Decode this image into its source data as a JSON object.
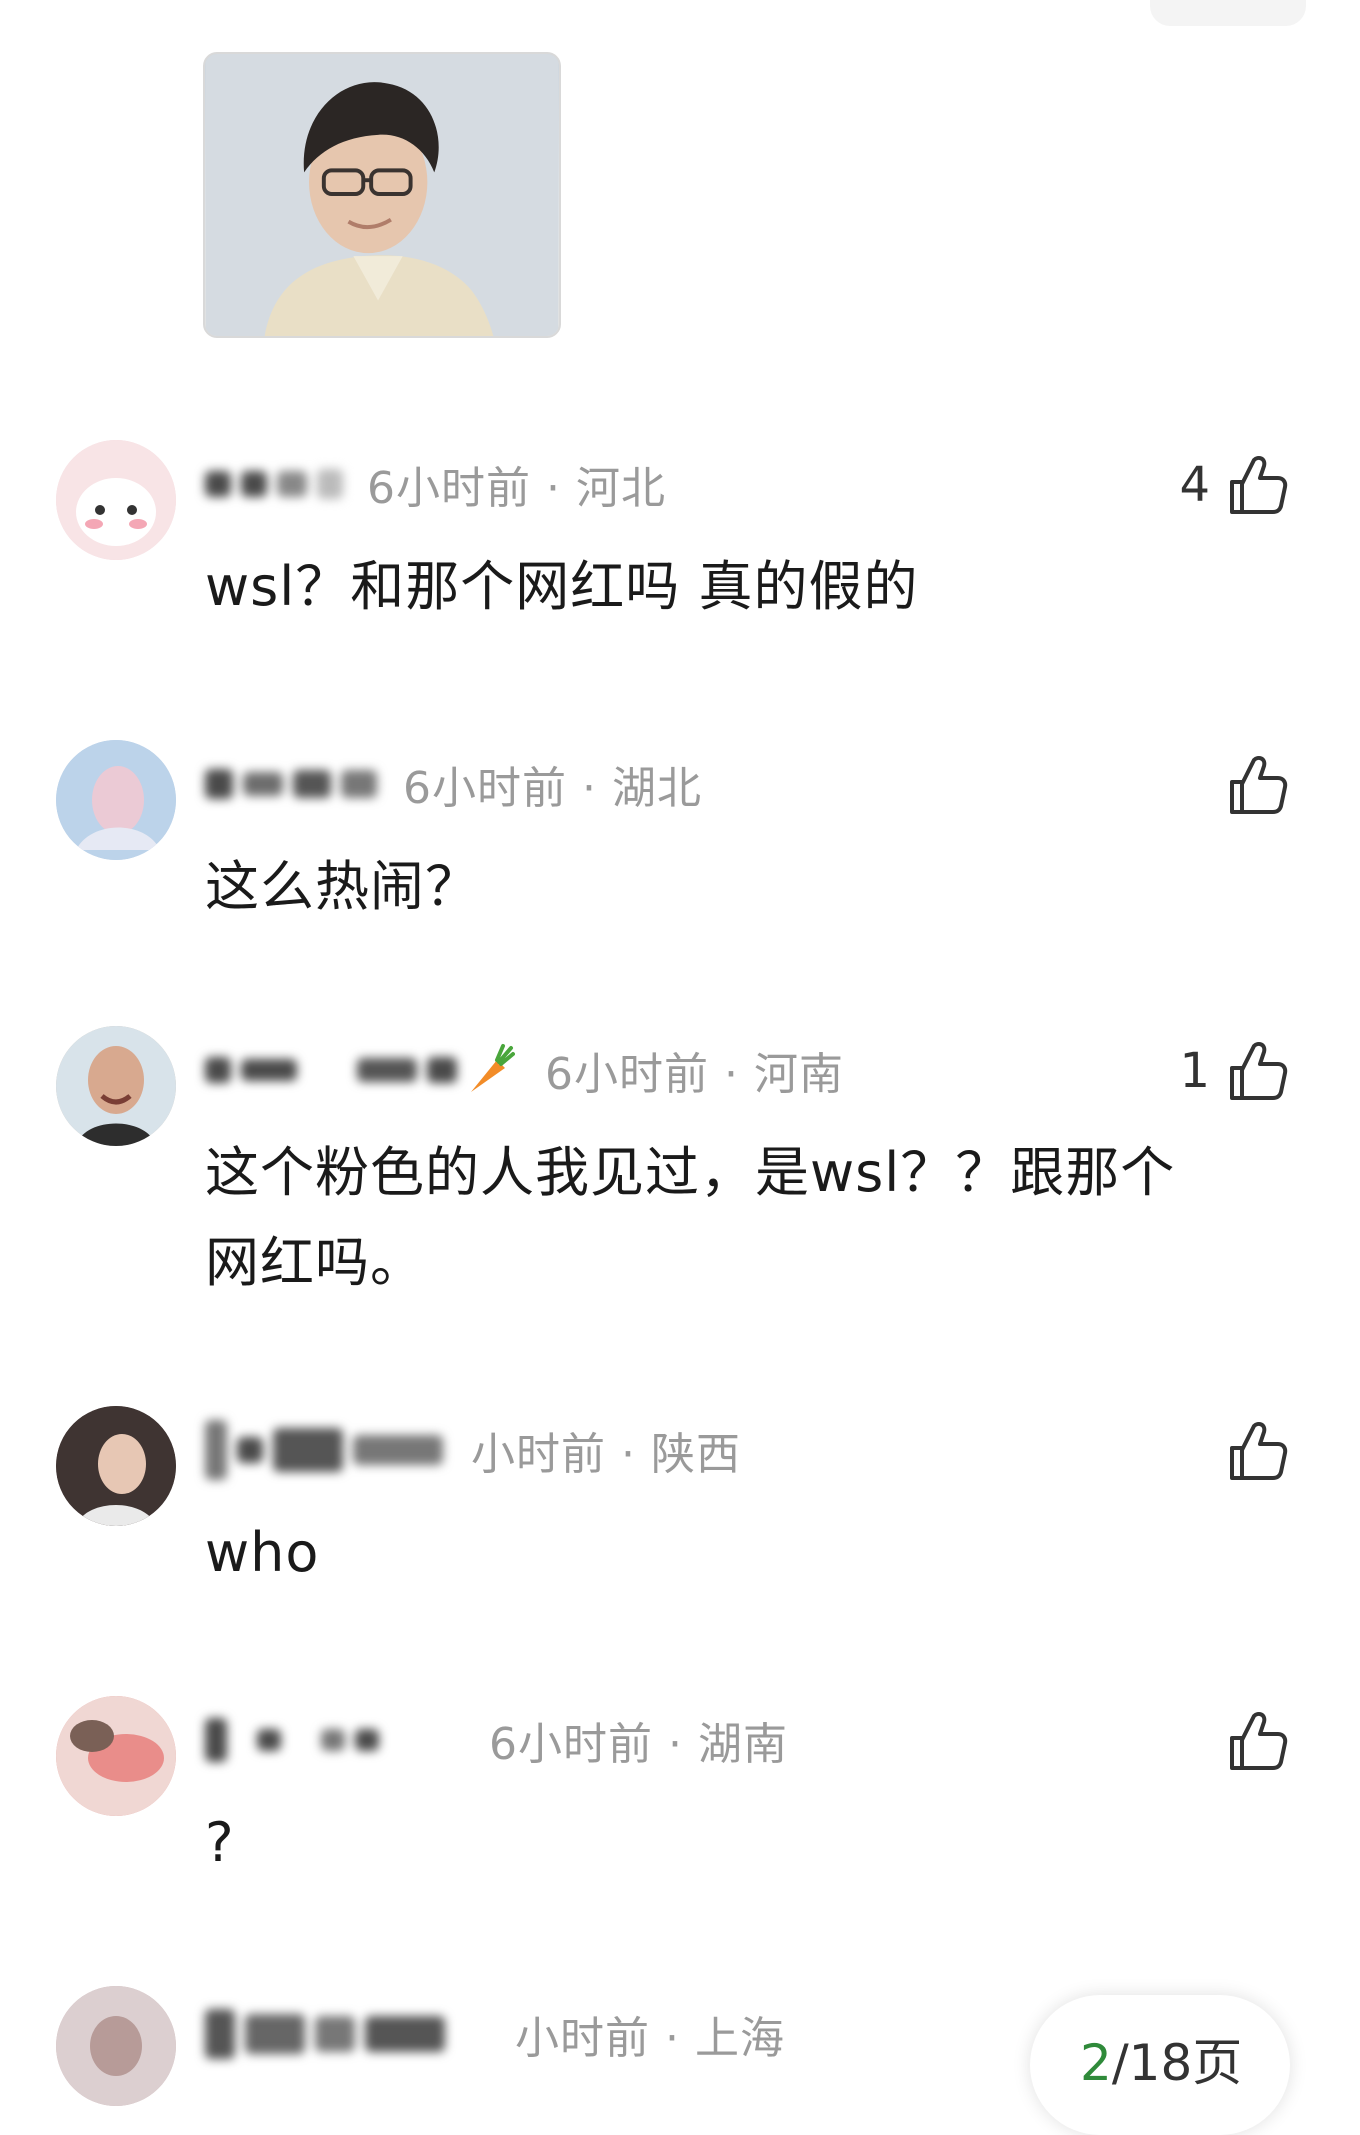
{
  "comments": [
    {
      "time_location": "6小时前 · 河北",
      "text": "wsl？和那个网红吗 真的假的",
      "likes": "4",
      "avatar_color": "#f3d8dc"
    },
    {
      "time_location": "6小时前 · 湖北",
      "text": "这么热闹？",
      "likes": "",
      "avatar_color": "#b9cfe6"
    },
    {
      "time_location": "6小时前 · 河南",
      "text_line1": "这个粉色的人我见过，是wsl？？跟那个",
      "text_line2": "网红吗。",
      "likes": "1",
      "avatar_color": "#c9c3bd"
    },
    {
      "time_location": "小时前 · 陕西",
      "text": "who",
      "likes": "",
      "avatar_color": "#5a4a48"
    },
    {
      "time_location": "6小时前 · 湖南",
      "text": "?",
      "likes": "",
      "avatar_color": "#e7a7a4"
    },
    {
      "time_location": "小时前 · 上海",
      "avatar_color": "#cdb6b8"
    }
  ],
  "pagination": {
    "current": "2",
    "total": "/18页"
  },
  "colors": {
    "meta_gray": "#9a9a9a",
    "text": "#1a1a1a",
    "page_current": "#2f8a3a"
  },
  "icons": {
    "like": "thumbs-up-outline-icon"
  }
}
